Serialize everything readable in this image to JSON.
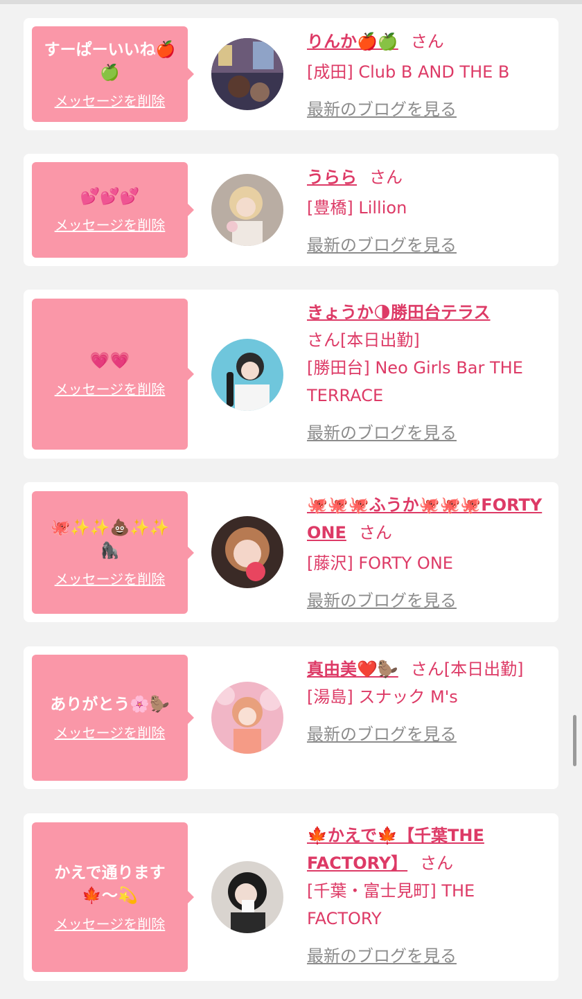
{
  "messages": [
    {
      "bubble_text": "すーぱーいいね🍎🍏",
      "delete_label": "メッセージを削除",
      "cast_name": "りんか🍎🍏",
      "san": "さん",
      "status": "",
      "shop": "[成田] Club B AND THE B",
      "blog_link": "最新のブログを見る"
    },
    {
      "bubble_text": "💕💕💕",
      "delete_label": "メッセージを削除",
      "cast_name": "うらら",
      "san": "さん",
      "status": "",
      "shop": "[豊橋] Lillion",
      "blog_link": "最新のブログを見る"
    },
    {
      "bubble_text": "💗💗",
      "delete_label": "メッセージを削除",
      "cast_name": "きょうか🌗勝田台テラス",
      "san": "さん",
      "status": "[本日出勤]",
      "shop": "[勝田台] Neo Girls Bar THE TERRACE",
      "blog_link": "最新のブログを見る"
    },
    {
      "bubble_text": "🐙✨✨💩✨✨🦍",
      "delete_label": "メッセージを削除",
      "cast_name": "🐙🐙🐙ふうか🐙🐙🐙FORTY ONE",
      "san": "さん",
      "status": "",
      "shop": "[藤沢] FORTY ONE",
      "blog_link": "最新のブログを見る"
    },
    {
      "bubble_text": "ありがとう🌸🦫",
      "delete_label": "メッセージを削除",
      "cast_name": "真由美❤️🦫",
      "san": "さん",
      "status": "[本日出勤]",
      "shop": "[湯島] スナック M's",
      "blog_link": "最新のブログを見る"
    },
    {
      "bubble_text": "かえで通ります🍁〜💫",
      "delete_label": "メッセージを削除",
      "cast_name": "🍁かえで🍁【千葉THE FACTORY】",
      "san": "さん",
      "status": "",
      "shop": "[千葉・富士見町] THE FACTORY",
      "blog_link": "最新のブログを見る"
    }
  ],
  "colors": {
    "accent": "#dd3a66",
    "bubble": "#fa97a8",
    "link_gray": "#8c8c8c",
    "background": "#f2f2f2"
  },
  "avatars": [
    "avatar-city-night",
    "avatar-blonde-flower",
    "avatar-bottle",
    "avatar-octopus",
    "avatar-pink-blossom",
    "avatar-dark-hair"
  ]
}
